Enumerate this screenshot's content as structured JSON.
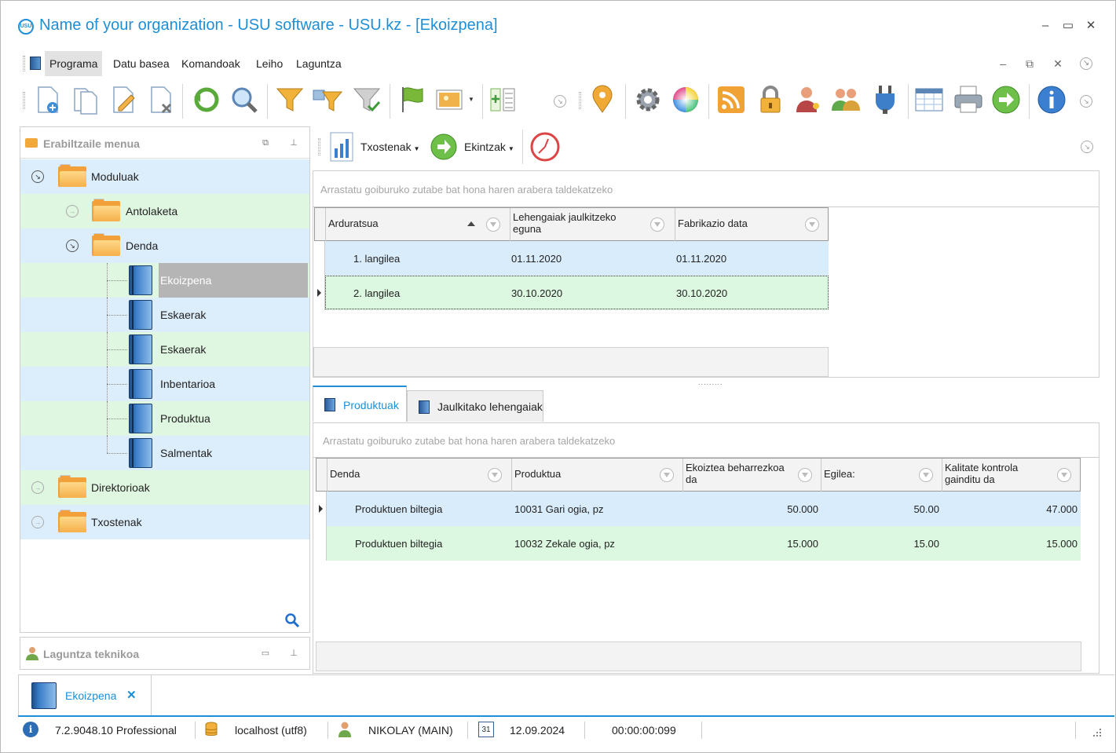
{
  "window": {
    "title": "Name of your organization - USU software - USU.kz - [Ekoizpena]",
    "logo_text": "USU",
    "minimize": "–",
    "maximize": "▭",
    "close": "✕"
  },
  "menu": {
    "items": [
      "Programa",
      "Datu basea",
      "Komandoak",
      "Leiho",
      "Laguntza"
    ],
    "mdi_minimize": "–",
    "mdi_restore": "⧉",
    "mdi_close": "✕"
  },
  "toolbar": {
    "icons": [
      "add-document-icon",
      "copy-document-icon",
      "edit-document-icon",
      "delete-document-icon",
      "refresh-icon",
      "search-icon",
      "filter-icon",
      "filter-settings-icon",
      "filter-check-icon",
      "flag-icon",
      "image-icon",
      "add-column-icon",
      "map-pin-icon",
      "settings-gear-icon",
      "color-wheel-icon",
      "rss-icon",
      "lock-icon",
      "user-key-icon",
      "users-icon",
      "plugin-icon",
      "table-icon",
      "printer-icon",
      "forward-arrow-icon",
      "info-icon"
    ]
  },
  "left_panel": {
    "title": "Erabiltzaile menua",
    "tree": [
      {
        "label": "Moduluak",
        "kind": "folder",
        "level": 0,
        "expanded": true
      },
      {
        "label": "Antolaketa",
        "kind": "folder",
        "level": 1,
        "expanded": false
      },
      {
        "label": "Denda",
        "kind": "folder",
        "level": 1,
        "expanded": true
      },
      {
        "label": "Ekoizpena",
        "kind": "book",
        "level": 2,
        "selected": true
      },
      {
        "label": "Eskaerak",
        "kind": "book",
        "level": 2
      },
      {
        "label": "Eskaerak",
        "kind": "book",
        "level": 2
      },
      {
        "label": "Inbentarioa",
        "kind": "book",
        "level": 2
      },
      {
        "label": "Produktua",
        "kind": "book",
        "level": 2
      },
      {
        "label": "Salmentak",
        "kind": "book",
        "level": 2
      },
      {
        "label": "Direktorioak",
        "kind": "folder",
        "level": 0,
        "expanded": false
      },
      {
        "label": "Txostenak",
        "kind": "folder",
        "level": 0,
        "expanded": false
      }
    ]
  },
  "help_panel": {
    "title": "Laguntza teknikoa"
  },
  "right_toolbar": {
    "reports_label": "Txostenak",
    "actions_label": "Ekintzak"
  },
  "grid1": {
    "group_hint": "Arrastatu goiburuko zutabe bat hona haren arabera taldekatzeko",
    "columns": [
      "Arduratsua",
      "Lehengaiak jaulkitzeko eguna",
      "Fabrikazio data"
    ],
    "rows": [
      [
        "1. langilea",
        "01.11.2020",
        "01.11.2020"
      ],
      [
        "2. langilea",
        "30.10.2020",
        "30.10.2020"
      ]
    ]
  },
  "tabs": {
    "items": [
      "Produktuak",
      "Jaulkitako lehengaiak"
    ],
    "active": 0
  },
  "grid2": {
    "group_hint": "Arrastatu goiburuko zutabe bat hona haren arabera taldekatzeko",
    "columns": [
      "Denda",
      "Produktua",
      "Ekoiztea beharrezkoa da",
      "Egilea:",
      "Kalitate kontrola gainditu da"
    ],
    "rows": [
      [
        "Produktuen biltegia",
        "10031 Gari ogia, pz",
        "50.000",
        "50.00",
        "47.000"
      ],
      [
        "Produktuen biltegia",
        "10032 Zekale ogia, pz",
        "15.000",
        "15.00",
        "15.000"
      ]
    ]
  },
  "doc_tab": {
    "label": "Ekoizpena",
    "close": "✕"
  },
  "status": {
    "version": "7.2.9048.10 Professional",
    "db": "localhost (utf8)",
    "user": "NIKOLAY (MAIN)",
    "calendar_day": "31",
    "date": "12.09.2024",
    "timer": "00:00:00:099"
  },
  "colors": {
    "accent": "#1e8fd6",
    "row_blue": "#d9ecfb",
    "row_green": "#dcf8e0",
    "selected_node": "#b5b5b5",
    "folder": "#f2a03a"
  }
}
